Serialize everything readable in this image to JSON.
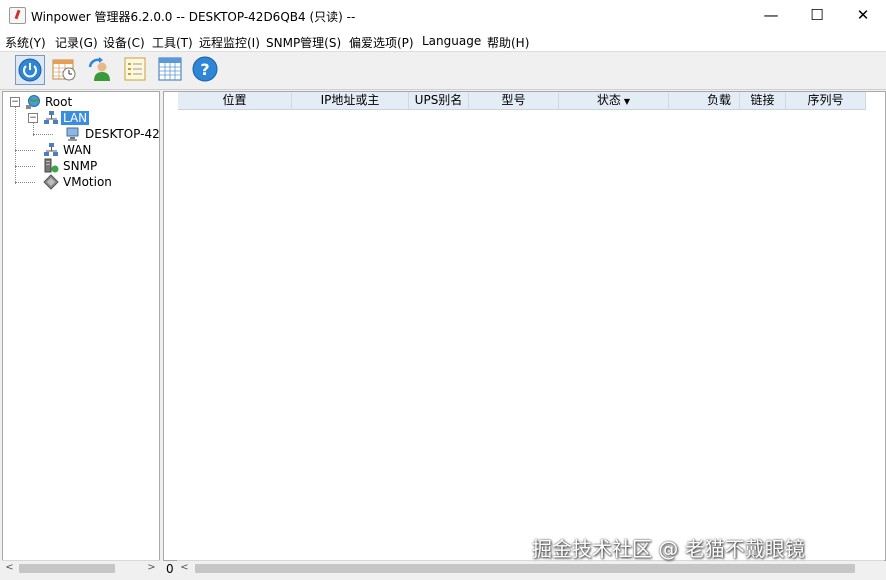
{
  "window": {
    "title": "Winpower 管理器6.2.0.0 -- DESKTOP-42D6QB4 (只读) --",
    "minimize_glyph": "—",
    "maximize_glyph": "☐",
    "close_glyph": "✕"
  },
  "menu": [
    {
      "label": "系统(Y)"
    },
    {
      "label": "记录(G)"
    },
    {
      "label": "设备(C)"
    },
    {
      "label": "工具(T)"
    },
    {
      "label": "远程监控(I)"
    },
    {
      "label": "SNMP管理(S)"
    },
    {
      "label": "偏爱选项(P)"
    },
    {
      "label": "Language"
    },
    {
      "label": "帮助(H)"
    }
  ],
  "toolbar": [
    {
      "icon": "power-icon"
    },
    {
      "icon": "calendar-clock-icon"
    },
    {
      "icon": "user-refresh-icon"
    },
    {
      "icon": "checklist-icon"
    },
    {
      "icon": "grid-table-icon"
    },
    {
      "icon": "help-icon"
    }
  ],
  "tree": {
    "root": {
      "label": "Root",
      "expander": "−"
    },
    "lan": {
      "label": "LAN",
      "expander": "−"
    },
    "desktop": {
      "label": "DESKTOP-42"
    },
    "wan": {
      "label": "WAN"
    },
    "snmp": {
      "label": "SNMP"
    },
    "vmotion": {
      "label": "VMotion"
    }
  },
  "table": {
    "columns": [
      {
        "label": "位置"
      },
      {
        "label": "IP地址或主"
      },
      {
        "label": "UPS别名"
      },
      {
        "label": "型号"
      },
      {
        "label": "状态",
        "sort": "▼"
      },
      {
        "label": "负载"
      },
      {
        "label": "链接"
      },
      {
        "label": "序列号"
      }
    ]
  },
  "status": {
    "count": "0"
  },
  "scroll": {
    "left_arrow": "<",
    "right_arrow": ">"
  },
  "watermark": "掘金技术社区 @ 老猫不戴眼镜",
  "colors": {
    "selection": "#3b8de0",
    "header_bg": "#e4ecf5"
  }
}
